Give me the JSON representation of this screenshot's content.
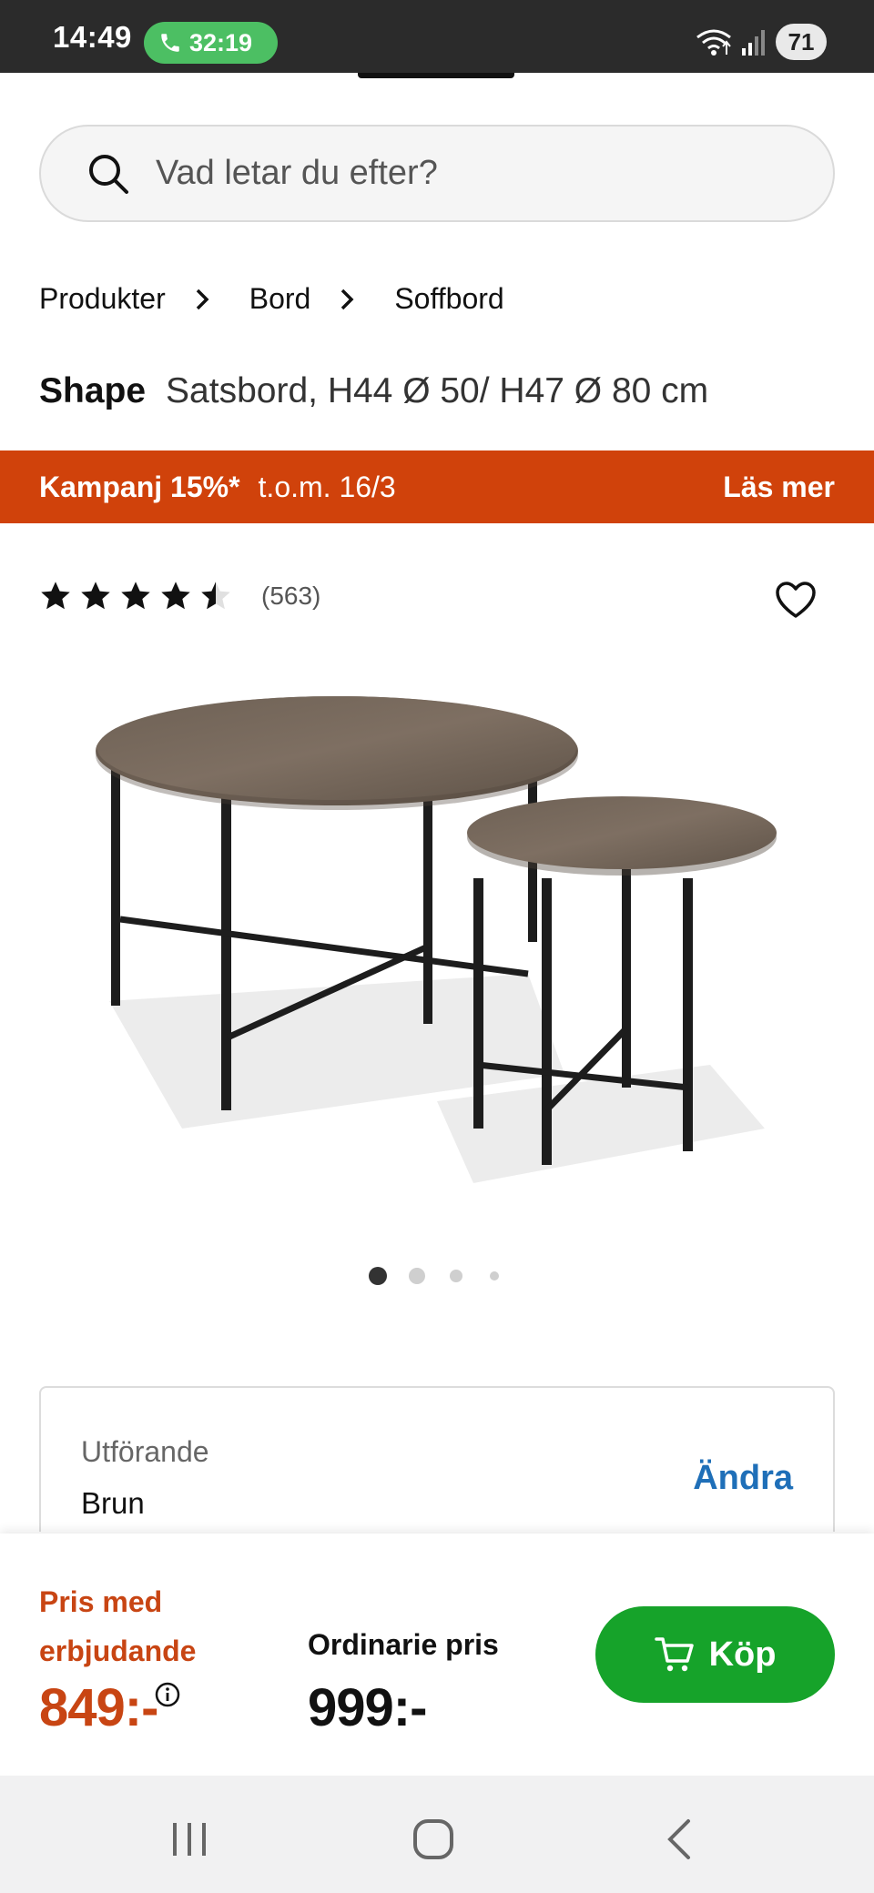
{
  "status_bar": {
    "time": "14:49",
    "call_duration": "32:19",
    "battery": "71"
  },
  "search": {
    "placeholder": "Vad letar du efter?"
  },
  "breadcrumb": [
    "Produkter",
    "Bord",
    "Soffbord"
  ],
  "product": {
    "brand": "Shape",
    "name": "Satsbord, H44 Ø 50/ H47 Ø 80 cm",
    "rating": 4.5,
    "review_count": "(563)"
  },
  "campaign": {
    "label": "Kampanj 15%*",
    "dates": "t.o.m. 16/3",
    "link": "Läs mer"
  },
  "carousel": {
    "total": 4,
    "active": 1
  },
  "variant": {
    "label": "Utförande",
    "value": "Brun",
    "change": "Ändra"
  },
  "purchase": {
    "offer_label": "Pris med erbjudande",
    "offer_price": "849:-",
    "regular_label": "Ordinarie pris",
    "regular_price": "999:-",
    "buy_label": "Köp"
  },
  "colors": {
    "campaign_orange": "#d0420b",
    "offer_price": "#c84513",
    "buy_green": "#16a32a",
    "link_blue": "#1f6fb8",
    "call_green": "#4cbf63"
  },
  "icons": {
    "search": "search-icon",
    "chevron": "chevron-right-icon",
    "star": "star-icon",
    "heart": "heart-icon",
    "info": "info-icon",
    "cart": "cart-icon",
    "phone": "phone-icon",
    "recents": "recents-icon",
    "home": "home-icon",
    "back": "back-icon"
  }
}
